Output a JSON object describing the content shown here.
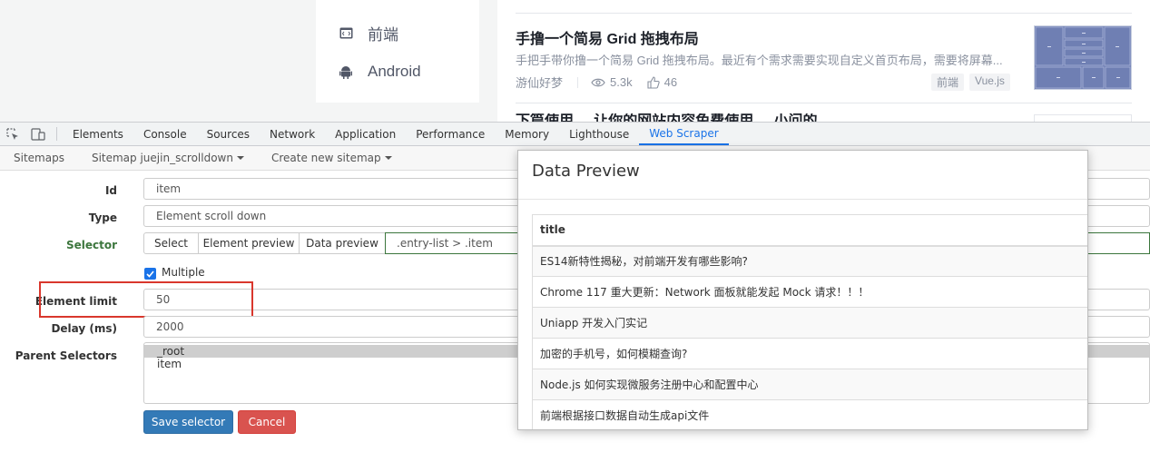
{
  "sidenav": {
    "items": [
      {
        "label": "前端",
        "icon": "code-icon"
      },
      {
        "label": "Android",
        "icon": "android-icon"
      }
    ]
  },
  "article": {
    "title": "手撸一个简易 Grid 拖拽布局",
    "abstract": "手把手带你撸一个简易 Grid 拖拽布局。最近有个需求需要实现自定义首页布局，需要将屏幕...",
    "author": "游仙好梦",
    "views": "5.3k",
    "likes": "46",
    "tags": [
      "前端",
      "Vue.js"
    ],
    "next_title": "下篇使用 ... 让你的网站内容免费使用 ... 小问的..."
  },
  "devtools": {
    "tabs": [
      "Elements",
      "Console",
      "Sources",
      "Network",
      "Application",
      "Performance",
      "Memory",
      "Lighthouse",
      "Web Scraper"
    ],
    "active_tab": "Web Scraper"
  },
  "scraper_nav": {
    "sitemaps": "Sitemaps",
    "sitemap_dropdown": "Sitemap juejin_scrolldown",
    "create": "Create new sitemap"
  },
  "form": {
    "id_label": "Id",
    "id_value": "item",
    "type_label": "Type",
    "type_value": "Element scroll down",
    "selector_label": "Selector",
    "select_btn": "Select",
    "element_preview_btn": "Element preview",
    "data_preview_btn": "Data preview",
    "selector_value": ".entry-list > .item",
    "multiple_label": "Multiple",
    "element_limit_label": "Element limit",
    "element_limit_value": "50",
    "delay_label": "Delay (ms)",
    "delay_value": "2000",
    "parent_label": "Parent Selectors",
    "parent_options": [
      "_root",
      "item"
    ],
    "save_btn": "Save selector",
    "cancel_btn": "Cancel"
  },
  "modal": {
    "title": "Data Preview",
    "column": "title",
    "rows": [
      "ES14新特性揭秘，对前端开发有哪些影响?",
      "Chrome 117 重大更新：Network 面板就能发起 Mock 请求！！！",
      "Uniapp 开发入门实记",
      "加密的手机号，如何模糊查询?",
      "Node.js 如何实现微服务注册中心和配置中心",
      "前端根据接口数据自动生成api文件"
    ]
  },
  "colors": {
    "accent": "#1a73e8",
    "primary_btn": "#337ab7",
    "danger_btn": "#d9534f",
    "highlight": "#d9372d",
    "selector_green": "#3c763d"
  }
}
